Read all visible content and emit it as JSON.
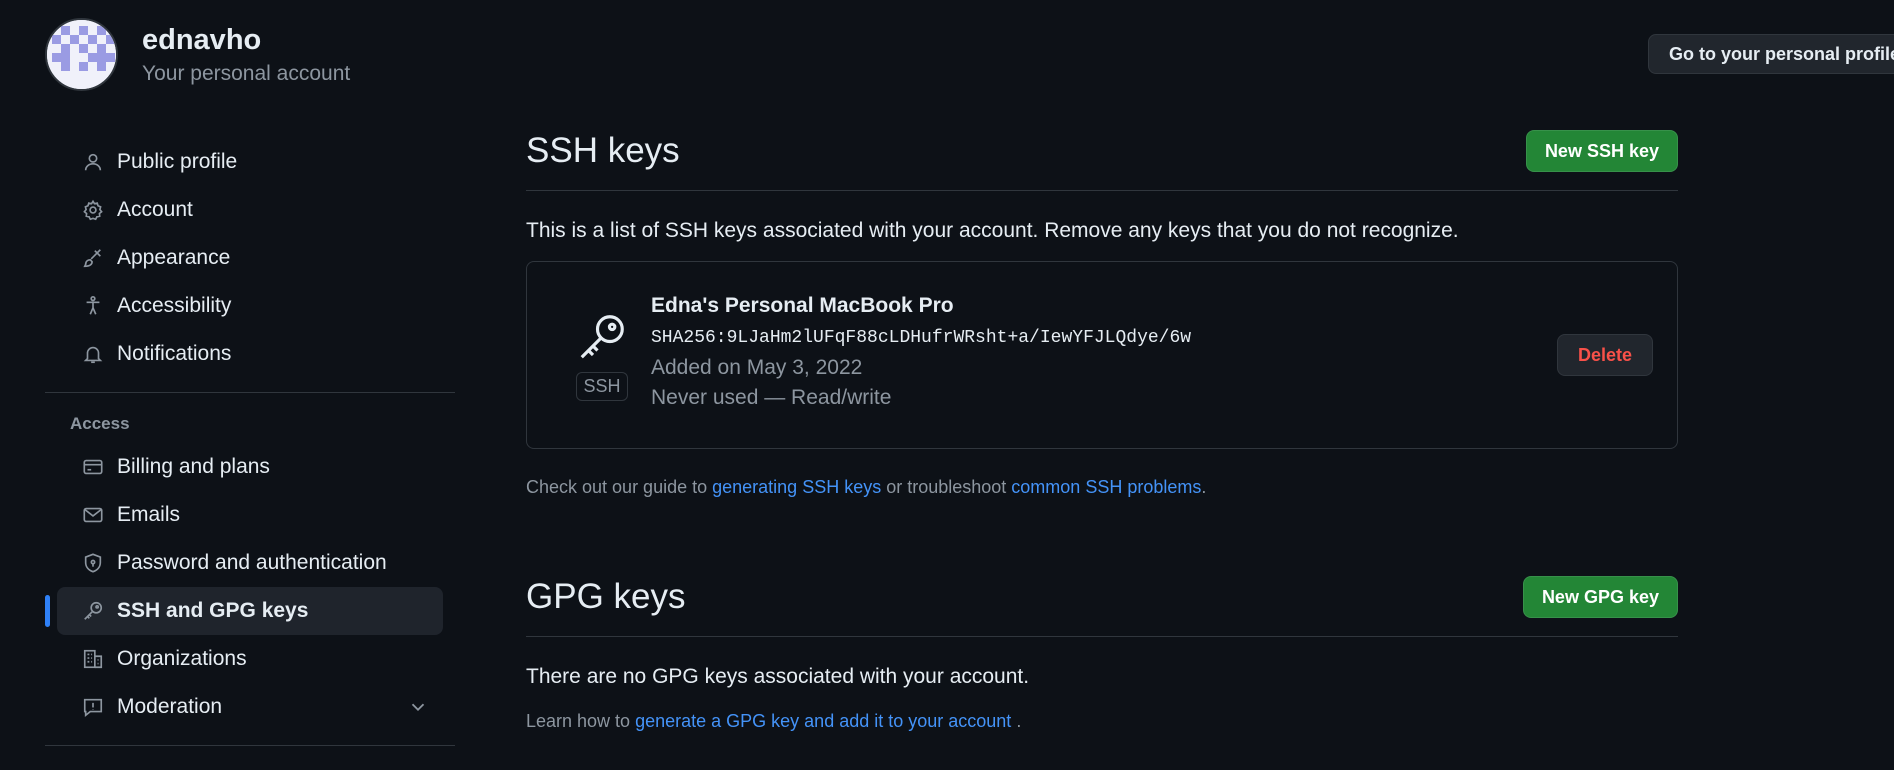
{
  "user": {
    "name": "ednavho",
    "account_type": "Your personal account",
    "profile_button": "Go to your personal profile"
  },
  "sidebar": {
    "items": [
      {
        "label": "Public profile",
        "icon": "person-icon"
      },
      {
        "label": "Account",
        "icon": "gear-icon"
      },
      {
        "label": "Appearance",
        "icon": "paintbrush-icon"
      },
      {
        "label": "Accessibility",
        "icon": "accessibility-icon"
      },
      {
        "label": "Notifications",
        "icon": "bell-icon"
      }
    ],
    "access_heading": "Access",
    "access_items": [
      {
        "label": "Billing and plans",
        "icon": "credit-card-icon"
      },
      {
        "label": "Emails",
        "icon": "mail-icon"
      },
      {
        "label": "Password and authentication",
        "icon": "shield-lock-icon"
      },
      {
        "label": "SSH and GPG keys",
        "icon": "key-icon",
        "active": true
      },
      {
        "label": "Organizations",
        "icon": "organization-icon"
      },
      {
        "label": "Moderation",
        "icon": "report-icon"
      }
    ]
  },
  "ssh": {
    "title": "SSH keys",
    "new_button": "New SSH key",
    "description": "This is a list of SSH keys associated with your account. Remove any keys that you do not recognize.",
    "key": {
      "badge": "SSH",
      "title": "Edna's Personal MacBook Pro",
      "fingerprint": "SHA256:9LJaHm2lUFqF88cLDHufrWRsht+a/IewYFJLQdye/6w",
      "added": "Added on May 3, 2022",
      "usage": "Never used — Read/write",
      "delete_button": "Delete"
    },
    "guide_prefix": "Check out our guide to ",
    "guide_link1": "generating SSH keys",
    "guide_middle": " or troubleshoot ",
    "guide_link2": "common SSH problems",
    "guide_suffix": "."
  },
  "gpg": {
    "title": "GPG keys",
    "new_button": "New GPG key",
    "empty": "There are no GPG keys associated with your account.",
    "learn_prefix": "Learn how to ",
    "learn_link": "generate a GPG key and add it to your account",
    "learn_suffix": " ."
  },
  "colors": {
    "background": "#0d1117",
    "primary_button": "#238636",
    "link": "#4493f8",
    "danger": "#f85149",
    "active_indicator": "#2f81f7"
  }
}
